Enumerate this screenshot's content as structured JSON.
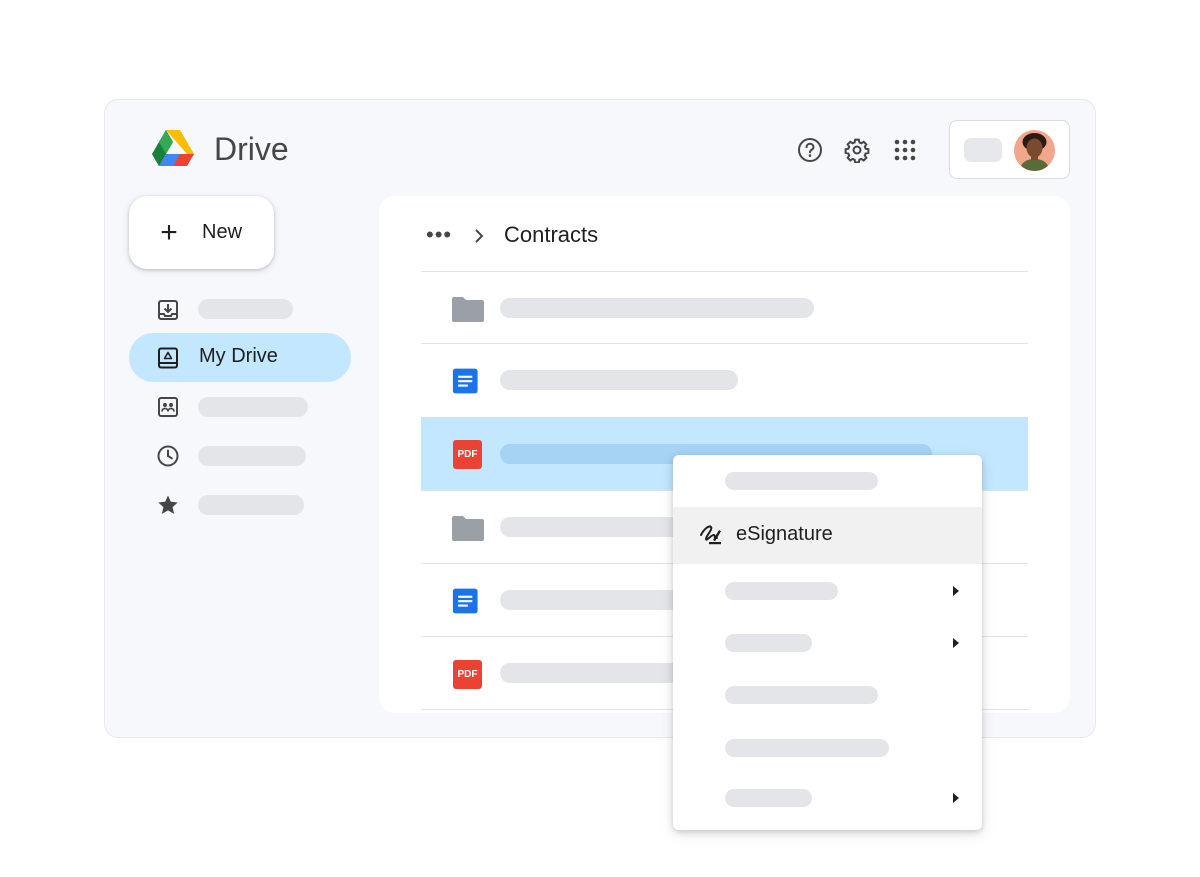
{
  "app": {
    "title": "Drive"
  },
  "header": {
    "icons": [
      "help-icon",
      "settings-gear-icon",
      "apps-grid-icon"
    ]
  },
  "sidebar": {
    "new_label": "New",
    "items": [
      {
        "icon": "download-tray-icon",
        "label": ""
      },
      {
        "icon": "drive-icon",
        "label": "My Drive",
        "active": true
      },
      {
        "icon": "shared-contacts-icon",
        "label": ""
      },
      {
        "icon": "clock-icon",
        "label": ""
      },
      {
        "icon": "star-icon",
        "label": ""
      }
    ]
  },
  "breadcrumb": {
    "more": "•••",
    "current": "Contracts"
  },
  "files": [
    {
      "type": "folder",
      "icon": "folder-icon"
    },
    {
      "type": "doc",
      "icon": "docs-icon"
    },
    {
      "type": "pdf",
      "icon": "pdf-icon",
      "selected": true
    },
    {
      "type": "folder",
      "icon": "folder-icon"
    },
    {
      "type": "doc",
      "icon": "docs-icon"
    },
    {
      "type": "pdf",
      "icon": "pdf-icon"
    }
  ],
  "pdf_badge": "PDF",
  "context_menu": {
    "highlighted_label": "eSignature",
    "highlighted_icon": "signature-icon",
    "submenu_arrow_icon": "triangle-right-icon"
  },
  "colors": {
    "accent_selected": "#c2e7ff",
    "docs_blue": "#1a73e8",
    "pdf_red": "#ea4335",
    "folder_grey": "#9aa0a6"
  }
}
